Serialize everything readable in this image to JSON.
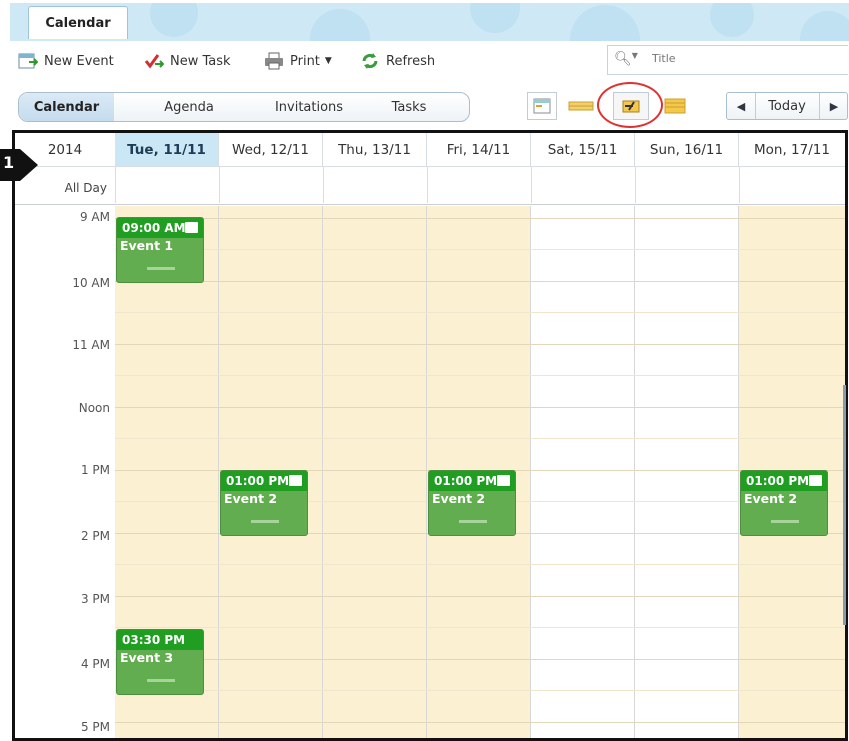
{
  "tab": {
    "label": "Calendar"
  },
  "toolbar": {
    "new_event": "New Event",
    "new_task": "New Task",
    "print": "Print",
    "refresh": "Refresh"
  },
  "search": {
    "placeholder": "Title"
  },
  "views": {
    "calendar": "Calendar",
    "agenda": "Agenda",
    "invitations": "Invitations",
    "tasks": "Tasks"
  },
  "nav": {
    "today": "Today"
  },
  "grid": {
    "year": "2014",
    "all_day": "All Day",
    "days": [
      "Tue, 11/11",
      "Wed, 12/11",
      "Thu, 13/11",
      "Fri, 14/11",
      "Sat, 15/11",
      "Sun, 16/11",
      "Mon, 17/11"
    ],
    "hours": [
      "9 AM",
      "10 AM",
      "11 AM",
      "Noon",
      "1 PM",
      "2 PM",
      "3 PM",
      "4 PM",
      "5 PM"
    ]
  },
  "events": [
    {
      "time": "09:00 AM",
      "title": "Event 1"
    },
    {
      "time": "01:00 PM",
      "title": "Event 2"
    },
    {
      "time": "01:00 PM",
      "title": "Event 2"
    },
    {
      "time": "01:00 PM",
      "title": "Event 2"
    },
    {
      "time": "03:30 PM",
      "title": "Event 3"
    }
  ],
  "badge": {
    "number": "1"
  },
  "colors": {
    "workday_bg": "#fcf0d2",
    "event_green": "#62ad4f",
    "event_header": "#1f9e22",
    "highlight_red": "#e03030",
    "selected_day_bg": "#cbe6f4"
  }
}
